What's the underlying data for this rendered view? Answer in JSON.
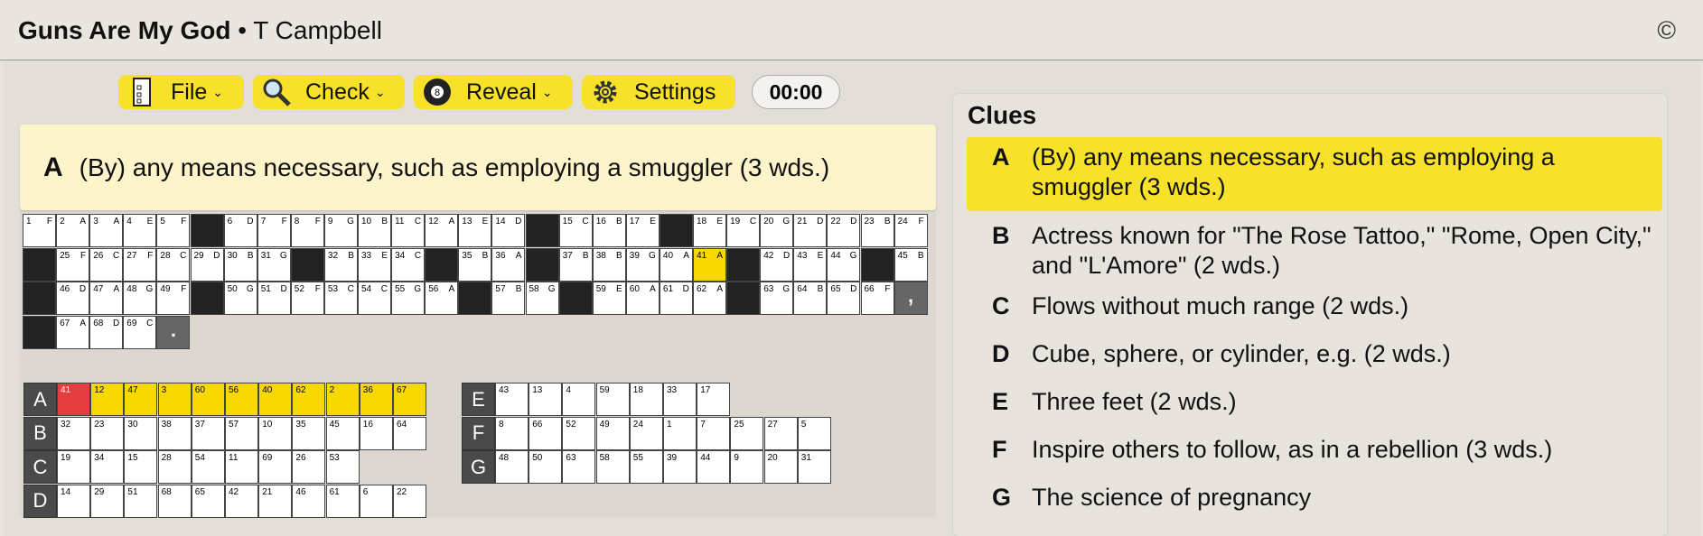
{
  "header": {
    "title": "Guns Are My God",
    "author": "• T Campbell",
    "copyright": "©"
  },
  "toolbar": {
    "file": {
      "label": "File",
      "icon": "file-icon"
    },
    "check": {
      "label": "Check",
      "icon": "magnifier-icon"
    },
    "reveal": {
      "label": "Reveal",
      "icon": "eight-ball-icon"
    },
    "settings": {
      "label": "Settings",
      "icon": "gear-icon"
    },
    "timer": "00:00"
  },
  "current_clue": {
    "letter": "A",
    "text": "(By) any means necessary, such as employing a smuggler (3 wds.)"
  },
  "grid_rows": [
    [
      [
        "1",
        "F"
      ],
      [
        "2",
        "A"
      ],
      [
        "3",
        "A"
      ],
      [
        "4",
        "E"
      ],
      [
        "5",
        "F"
      ],
      null,
      [
        "6",
        "D"
      ],
      [
        "7",
        "F"
      ],
      [
        "8",
        "F"
      ],
      [
        "9",
        "G"
      ],
      [
        "10",
        "B"
      ],
      [
        "11",
        "C"
      ],
      [
        "12",
        "A"
      ],
      [
        "13",
        "E"
      ],
      [
        "14",
        "D"
      ],
      null,
      [
        "15",
        "C"
      ],
      [
        "16",
        "B"
      ],
      [
        "17",
        "E"
      ],
      null,
      [
        "18",
        "E"
      ],
      [
        "19",
        "C"
      ],
      [
        "20",
        "G"
      ],
      [
        "21",
        "D"
      ],
      [
        "22",
        "D"
      ],
      [
        "23",
        "B"
      ],
      [
        "24",
        "F"
      ]
    ],
    [
      null,
      [
        "25",
        "F"
      ],
      [
        "26",
        "C"
      ],
      [
        "27",
        "F"
      ],
      [
        "28",
        "C"
      ],
      [
        "29",
        "D"
      ],
      [
        "30",
        "B"
      ],
      [
        "31",
        "G"
      ],
      null,
      [
        "32",
        "B"
      ],
      [
        "33",
        "E"
      ],
      [
        "34",
        "C"
      ],
      null,
      [
        "35",
        "B"
      ],
      [
        "36",
        "A"
      ],
      null,
      [
        "37",
        "B"
      ],
      [
        "38",
        "B"
      ],
      [
        "39",
        "G"
      ],
      [
        "40",
        "A"
      ],
      [
        "41",
        "A",
        "hl"
      ],
      null,
      [
        "42",
        "D"
      ],
      [
        "43",
        "E"
      ],
      [
        "44",
        "G"
      ],
      null,
      [
        "45",
        "B"
      ]
    ],
    [
      null,
      [
        "46",
        "D"
      ],
      [
        "47",
        "A"
      ],
      [
        "48",
        "G"
      ],
      [
        "49",
        "F"
      ],
      null,
      [
        "50",
        "G"
      ],
      [
        "51",
        "D"
      ],
      [
        "52",
        "F"
      ],
      [
        "53",
        "C"
      ],
      [
        "54",
        "C"
      ],
      [
        "55",
        "G"
      ],
      [
        "56",
        "A"
      ],
      null,
      [
        "57",
        "B"
      ],
      [
        "58",
        "G"
      ],
      null,
      [
        "59",
        "E"
      ],
      [
        "60",
        "A"
      ],
      [
        "61",
        "D"
      ],
      [
        "62",
        "A"
      ],
      null,
      [
        "63",
        "G"
      ],
      [
        "64",
        "B"
      ],
      [
        "65",
        "D"
      ],
      [
        "66",
        "F"
      ],
      [
        ",",
        "",
        "punct"
      ]
    ],
    [
      null,
      [
        "67",
        "A"
      ],
      [
        "68",
        "D"
      ],
      [
        "69",
        "C"
      ],
      [
        ".",
        "",
        "punct"
      ]
    ]
  ],
  "quote_left": [
    {
      "label": "A",
      "cells": [
        "41",
        "12",
        "47",
        "3",
        "60",
        "56",
        "40",
        "62",
        "2",
        "36",
        "67"
      ],
      "active": true
    },
    {
      "label": "B",
      "cells": [
        "32",
        "23",
        "30",
        "38",
        "37",
        "57",
        "10",
        "35",
        "45",
        "16",
        "64"
      ]
    },
    {
      "label": "C",
      "cells": [
        "19",
        "34",
        "15",
        "28",
        "54",
        "11",
        "69",
        "26",
        "53"
      ]
    },
    {
      "label": "D",
      "cells": [
        "14",
        "29",
        "51",
        "68",
        "65",
        "42",
        "21",
        "46",
        "61",
        "6",
        "22"
      ]
    }
  ],
  "quote_right": [
    {
      "label": "E",
      "cells": [
        "43",
        "13",
        "4",
        "59",
        "18",
        "33",
        "17"
      ]
    },
    {
      "label": "F",
      "cells": [
        "8",
        "66",
        "52",
        "49",
        "24",
        "1",
        "7",
        "25",
        "27",
        "5"
      ]
    },
    {
      "label": "G",
      "cells": [
        "48",
        "50",
        "63",
        "58",
        "55",
        "39",
        "44",
        "9",
        "20",
        "31"
      ]
    }
  ],
  "clues_title": "Clues",
  "clues": [
    {
      "letter": "A",
      "text": "(By) any means necessary, such as employing a smuggler (3 wds.)"
    },
    {
      "letter": "B",
      "text": "Actress known for \"The Rose Tattoo,\" \"Rome, Open City,\" and \"L'Amore\" (2 wds.)"
    },
    {
      "letter": "C",
      "text": "Flows without much range (2 wds.)"
    },
    {
      "letter": "D",
      "text": "Cube, sphere, or cylinder, e.g. (2 wds.)"
    },
    {
      "letter": "E",
      "text": "Three feet (2 wds.)"
    },
    {
      "letter": "F",
      "text": "Inspire others to follow, as in a rebellion (3 wds.)"
    },
    {
      "letter": "G",
      "text": "The science of pregnancy"
    }
  ]
}
